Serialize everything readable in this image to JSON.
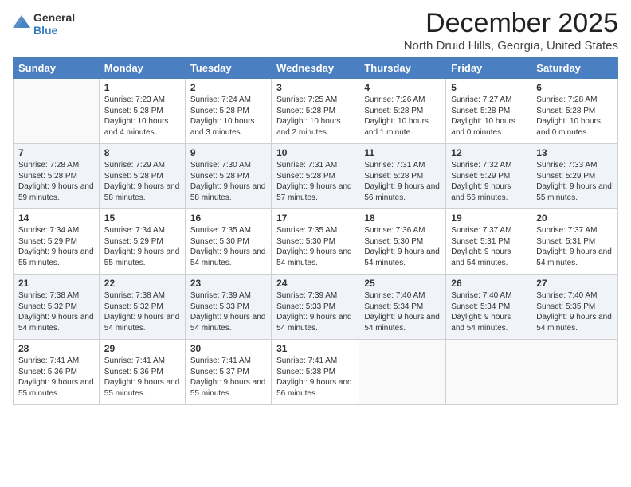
{
  "logo": {
    "general": "General",
    "blue": "Blue"
  },
  "header": {
    "month": "December 2025",
    "location": "North Druid Hills, Georgia, United States"
  },
  "weekdays": [
    "Sunday",
    "Monday",
    "Tuesday",
    "Wednesday",
    "Thursday",
    "Friday",
    "Saturday"
  ],
  "weeks": [
    [
      {
        "day": "",
        "sunrise": "",
        "sunset": "",
        "daylight": ""
      },
      {
        "day": "1",
        "sunrise": "Sunrise: 7:23 AM",
        "sunset": "Sunset: 5:28 PM",
        "daylight": "Daylight: 10 hours and 4 minutes."
      },
      {
        "day": "2",
        "sunrise": "Sunrise: 7:24 AM",
        "sunset": "Sunset: 5:28 PM",
        "daylight": "Daylight: 10 hours and 3 minutes."
      },
      {
        "day": "3",
        "sunrise": "Sunrise: 7:25 AM",
        "sunset": "Sunset: 5:28 PM",
        "daylight": "Daylight: 10 hours and 2 minutes."
      },
      {
        "day": "4",
        "sunrise": "Sunrise: 7:26 AM",
        "sunset": "Sunset: 5:28 PM",
        "daylight": "Daylight: 10 hours and 1 minute."
      },
      {
        "day": "5",
        "sunrise": "Sunrise: 7:27 AM",
        "sunset": "Sunset: 5:28 PM",
        "daylight": "Daylight: 10 hours and 0 minutes."
      },
      {
        "day": "6",
        "sunrise": "Sunrise: 7:28 AM",
        "sunset": "Sunset: 5:28 PM",
        "daylight": "Daylight: 10 hours and 0 minutes."
      }
    ],
    [
      {
        "day": "7",
        "sunrise": "Sunrise: 7:28 AM",
        "sunset": "Sunset: 5:28 PM",
        "daylight": "Daylight: 9 hours and 59 minutes."
      },
      {
        "day": "8",
        "sunrise": "Sunrise: 7:29 AM",
        "sunset": "Sunset: 5:28 PM",
        "daylight": "Daylight: 9 hours and 58 minutes."
      },
      {
        "day": "9",
        "sunrise": "Sunrise: 7:30 AM",
        "sunset": "Sunset: 5:28 PM",
        "daylight": "Daylight: 9 hours and 58 minutes."
      },
      {
        "day": "10",
        "sunrise": "Sunrise: 7:31 AM",
        "sunset": "Sunset: 5:28 PM",
        "daylight": "Daylight: 9 hours and 57 minutes."
      },
      {
        "day": "11",
        "sunrise": "Sunrise: 7:31 AM",
        "sunset": "Sunset: 5:28 PM",
        "daylight": "Daylight: 9 hours and 56 minutes."
      },
      {
        "day": "12",
        "sunrise": "Sunrise: 7:32 AM",
        "sunset": "Sunset: 5:29 PM",
        "daylight": "Daylight: 9 hours and 56 minutes."
      },
      {
        "day": "13",
        "sunrise": "Sunrise: 7:33 AM",
        "sunset": "Sunset: 5:29 PM",
        "daylight": "Daylight: 9 hours and 55 minutes."
      }
    ],
    [
      {
        "day": "14",
        "sunrise": "Sunrise: 7:34 AM",
        "sunset": "Sunset: 5:29 PM",
        "daylight": "Daylight: 9 hours and 55 minutes."
      },
      {
        "day": "15",
        "sunrise": "Sunrise: 7:34 AM",
        "sunset": "Sunset: 5:29 PM",
        "daylight": "Daylight: 9 hours and 55 minutes."
      },
      {
        "day": "16",
        "sunrise": "Sunrise: 7:35 AM",
        "sunset": "Sunset: 5:30 PM",
        "daylight": "Daylight: 9 hours and 54 minutes."
      },
      {
        "day": "17",
        "sunrise": "Sunrise: 7:35 AM",
        "sunset": "Sunset: 5:30 PM",
        "daylight": "Daylight: 9 hours and 54 minutes."
      },
      {
        "day": "18",
        "sunrise": "Sunrise: 7:36 AM",
        "sunset": "Sunset: 5:30 PM",
        "daylight": "Daylight: 9 hours and 54 minutes."
      },
      {
        "day": "19",
        "sunrise": "Sunrise: 7:37 AM",
        "sunset": "Sunset: 5:31 PM",
        "daylight": "Daylight: 9 hours and 54 minutes."
      },
      {
        "day": "20",
        "sunrise": "Sunrise: 7:37 AM",
        "sunset": "Sunset: 5:31 PM",
        "daylight": "Daylight: 9 hours and 54 minutes."
      }
    ],
    [
      {
        "day": "21",
        "sunrise": "Sunrise: 7:38 AM",
        "sunset": "Sunset: 5:32 PM",
        "daylight": "Daylight: 9 hours and 54 minutes."
      },
      {
        "day": "22",
        "sunrise": "Sunrise: 7:38 AM",
        "sunset": "Sunset: 5:32 PM",
        "daylight": "Daylight: 9 hours and 54 minutes."
      },
      {
        "day": "23",
        "sunrise": "Sunrise: 7:39 AM",
        "sunset": "Sunset: 5:33 PM",
        "daylight": "Daylight: 9 hours and 54 minutes."
      },
      {
        "day": "24",
        "sunrise": "Sunrise: 7:39 AM",
        "sunset": "Sunset: 5:33 PM",
        "daylight": "Daylight: 9 hours and 54 minutes."
      },
      {
        "day": "25",
        "sunrise": "Sunrise: 7:40 AM",
        "sunset": "Sunset: 5:34 PM",
        "daylight": "Daylight: 9 hours and 54 minutes."
      },
      {
        "day": "26",
        "sunrise": "Sunrise: 7:40 AM",
        "sunset": "Sunset: 5:34 PM",
        "daylight": "Daylight: 9 hours and 54 minutes."
      },
      {
        "day": "27",
        "sunrise": "Sunrise: 7:40 AM",
        "sunset": "Sunset: 5:35 PM",
        "daylight": "Daylight: 9 hours and 54 minutes."
      }
    ],
    [
      {
        "day": "28",
        "sunrise": "Sunrise: 7:41 AM",
        "sunset": "Sunset: 5:36 PM",
        "daylight": "Daylight: 9 hours and 55 minutes."
      },
      {
        "day": "29",
        "sunrise": "Sunrise: 7:41 AM",
        "sunset": "Sunset: 5:36 PM",
        "daylight": "Daylight: 9 hours and 55 minutes."
      },
      {
        "day": "30",
        "sunrise": "Sunrise: 7:41 AM",
        "sunset": "Sunset: 5:37 PM",
        "daylight": "Daylight: 9 hours and 55 minutes."
      },
      {
        "day": "31",
        "sunrise": "Sunrise: 7:41 AM",
        "sunset": "Sunset: 5:38 PM",
        "daylight": "Daylight: 9 hours and 56 minutes."
      },
      {
        "day": "",
        "sunrise": "",
        "sunset": "",
        "daylight": ""
      },
      {
        "day": "",
        "sunrise": "",
        "sunset": "",
        "daylight": ""
      },
      {
        "day": "",
        "sunrise": "",
        "sunset": "",
        "daylight": ""
      }
    ]
  ]
}
